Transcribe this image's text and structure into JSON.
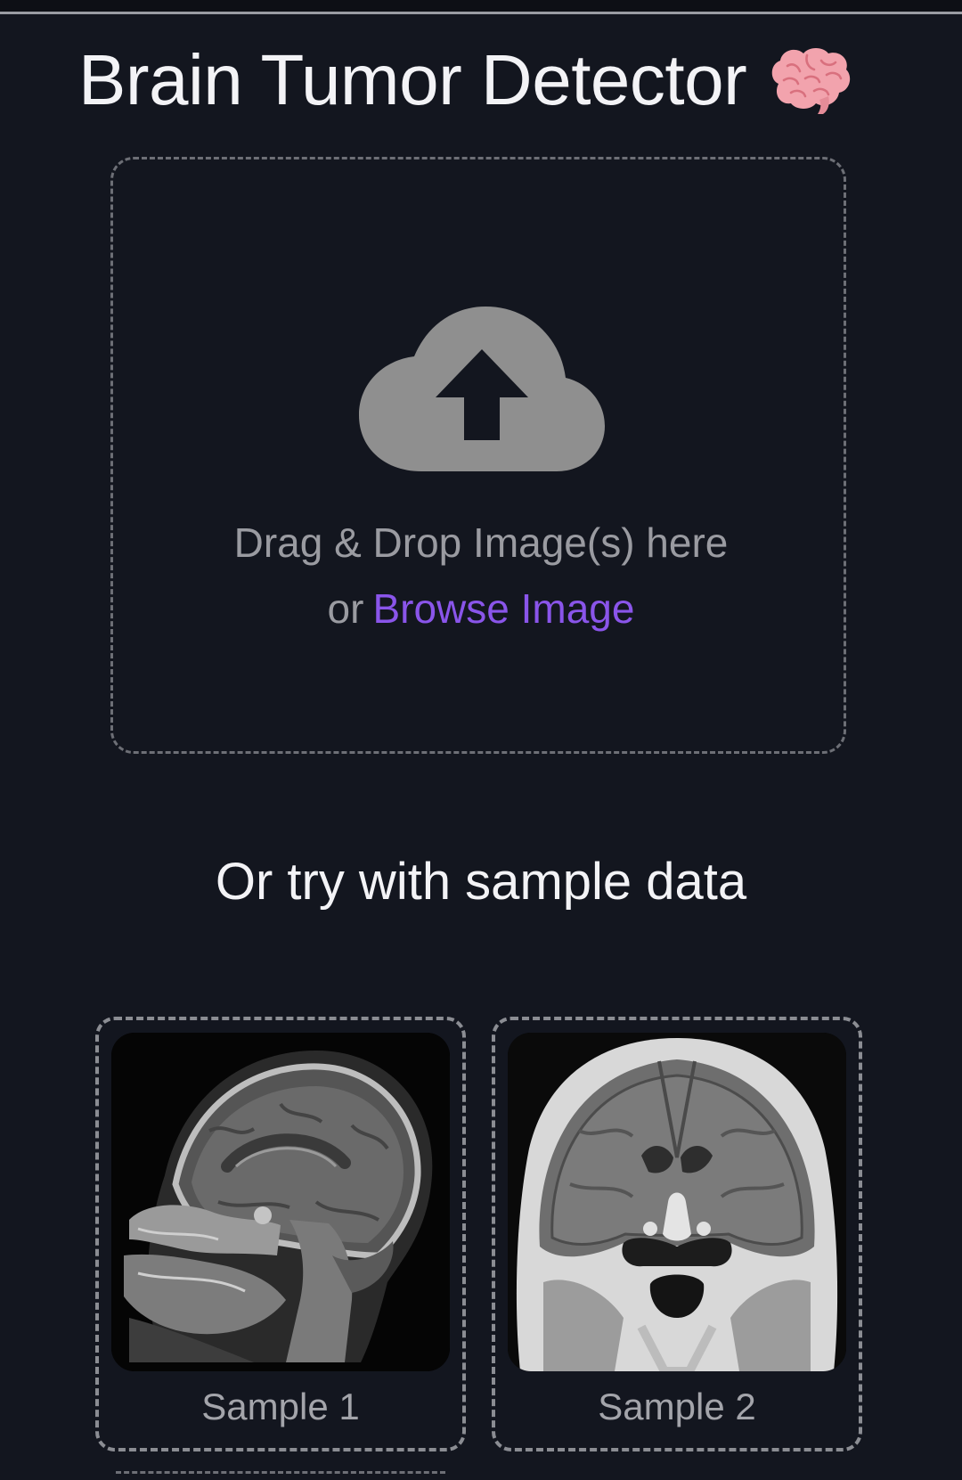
{
  "header": {
    "title": "Brain Tumor Detector",
    "title_icon": "brain-emoji-icon"
  },
  "upload": {
    "icon": "cloud-upload-icon",
    "drag_text": "Drag & Drop Image(s) here",
    "or_text": "or",
    "browse_label": "Browse Image",
    "colors": {
      "link": "#8a55ea",
      "muted_text": "#9a9ba1",
      "icon": "#8f8f8f"
    }
  },
  "samples": {
    "heading": "Or try with sample data",
    "items": [
      {
        "label": "Sample 1",
        "image": "sagittal-brain-mri"
      },
      {
        "label": "Sample 2",
        "image": "coronal-brain-mri"
      }
    ]
  },
  "theme": {
    "background": "#13161f",
    "heading_text": "#f3f3f6",
    "dashed_border": "#8b8d93"
  }
}
